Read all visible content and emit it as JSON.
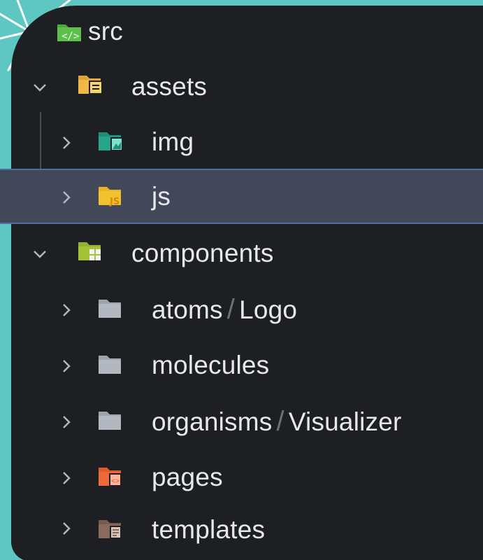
{
  "tree": {
    "root": {
      "label": "src"
    },
    "assets": {
      "label": "assets",
      "children": {
        "img": "img",
        "js": "js"
      }
    },
    "components": {
      "label": "components",
      "children": {
        "atoms_folder": "atoms",
        "atoms_sub": "Logo",
        "molecules": "molecules",
        "organisms_folder": "organisms",
        "organisms_sub": "Visualizer",
        "pages": "pages",
        "templates": "templates"
      }
    },
    "selected": "js",
    "path_separator": "/"
  },
  "colors": {
    "background": "#5ec7c3",
    "panel": "#1e1f22",
    "selection": "#43475a",
    "selection_border": "#4f6ea0",
    "text": "#e7e8ec",
    "src_folder": "#4aa83c",
    "assets_folder": "#e0a33a",
    "img_folder": "#1f8f7a",
    "js_folder": "#f2c12e",
    "components_folder": "#a6c23a",
    "plain_folder": "#b3b7bf",
    "pages_folder": "#ef6a3a",
    "templates_folder": "#8a6a5a"
  },
  "icons": {
    "src": "source-code-folder-icon",
    "assets": "assets-folder-icon",
    "img": "image-folder-icon",
    "js": "javascript-folder-icon",
    "components": "components-folder-icon",
    "folder": "folder-icon",
    "pages": "pages-folder-icon",
    "templates": "templates-folder-icon"
  }
}
